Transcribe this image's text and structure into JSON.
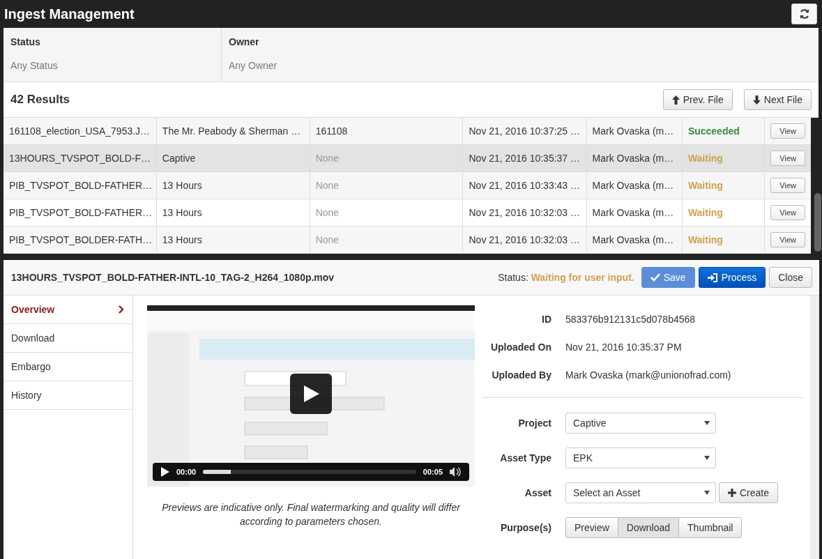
{
  "window": {
    "title": "Ingest Management"
  },
  "filters": [
    {
      "label": "Status",
      "value": "Any Status"
    },
    {
      "label": "Owner",
      "value": "Any Owner"
    }
  ],
  "results": {
    "count": "42 Results",
    "buttons": [
      {
        "label": "Prev. File",
        "kind": "up"
      },
      {
        "label": "Next File",
        "kind": "down"
      }
    ]
  },
  "table": {
    "rows": [
      {
        "file": "161108_election_USA_7953.J…",
        "project": "The Mr. Peabody & Sherman …",
        "reference": "161108",
        "reference_empty": false,
        "date": "Nov 21, 2016 10:37:25 …",
        "owner": "Mark Ovaska (m…",
        "status": {
          "label": "Succeeded",
          "color": "#3c8d3c"
        },
        "action": "View",
        "selected": false
      },
      {
        "file": "13HOURS_TVSPOT_BOLD-F…",
        "project": "Captive",
        "reference": "None",
        "reference_empty": true,
        "date": "Nov 21, 2016 10:35:37 …",
        "owner": "Mark Ovaska (m…",
        "status": {
          "label": "Waiting",
          "color": "#d0a050"
        },
        "action": "View",
        "selected": true
      },
      {
        "file": "PIB_TVSPOT_BOLD-FATHER…",
        "project": "13 Hours",
        "reference": "None",
        "reference_empty": true,
        "date": "Nov 21, 2016 10:33:43 …",
        "owner": "Mark Ovaska (m…",
        "status": {
          "label": "Waiting",
          "color": "#d0a050"
        },
        "action": "View",
        "selected": false
      },
      {
        "file": "PIB_TVSPOT_BOLD-FATHER…",
        "project": "13 Hours",
        "reference": "None",
        "reference_empty": true,
        "date": "Nov 21, 2016 10:32:03 …",
        "owner": "Mark Ovaska (m…",
        "status": {
          "label": "Waiting",
          "color": "#d0a050"
        },
        "action": "View",
        "selected": false
      },
      {
        "file": "PIB_TVSPOT_BOLDER-FATH…",
        "project": "13 Hours",
        "reference": "None",
        "reference_empty": true,
        "date": "Nov 21, 2016 10:32:03 …",
        "owner": "Mark Ovaska (m…",
        "status": {
          "label": "Waiting",
          "color": "#d0a050"
        },
        "action": "View",
        "selected": false
      }
    ]
  },
  "detail": {
    "title": "13HOURS_TVSPOT_BOLD-FATHER-INTL-10_TAG-2_H264_1080p.mov",
    "status_label": "Status:",
    "status": "Waiting for user input.",
    "buttons": [
      {
        "label": "Save",
        "kind": "save",
        "disabled": true
      },
      {
        "label": "Process",
        "kind": "process",
        "disabled": false
      },
      {
        "label": "Close",
        "kind": "close",
        "disabled": false
      }
    ],
    "nav": [
      {
        "label": "Overview",
        "selected": true
      },
      {
        "label": "Download",
        "selected": false
      },
      {
        "label": "Embargo",
        "selected": false
      },
      {
        "label": "History",
        "selected": false
      }
    ],
    "video": {
      "kind": "picture",
      "time": "00:00",
      "duration": "00:05",
      "level": 0.13
    },
    "caption": "Previews are indicative only. Final watermarking and quality will differ according to parameters chosen.",
    "info": [
      {
        "label": "ID",
        "value": "583376b912131c5d078b4568"
      },
      {
        "label": "Uploaded On",
        "value": "Nov 21, 2016 10:35:37 PM"
      },
      {
        "label": "Uploaded By",
        "value": "Mark Ovaska (mark@unionofrad.com)"
      }
    ],
    "form": [
      {
        "kind": "select",
        "label": "Project",
        "value": "Captive"
      },
      {
        "kind": "select",
        "label": "Asset Type",
        "value": "EPK"
      },
      {
        "kind": "select_create",
        "label": "Asset",
        "value": "Select an Asset",
        "button": "Create"
      },
      {
        "kind": "toggle",
        "label": "Purpose(s)",
        "options": [
          {
            "label": "Preview",
            "selected": false
          },
          {
            "label": "Download",
            "selected": true
          },
          {
            "label": "Thumbnail",
            "selected": false
          }
        ]
      }
    ]
  }
}
